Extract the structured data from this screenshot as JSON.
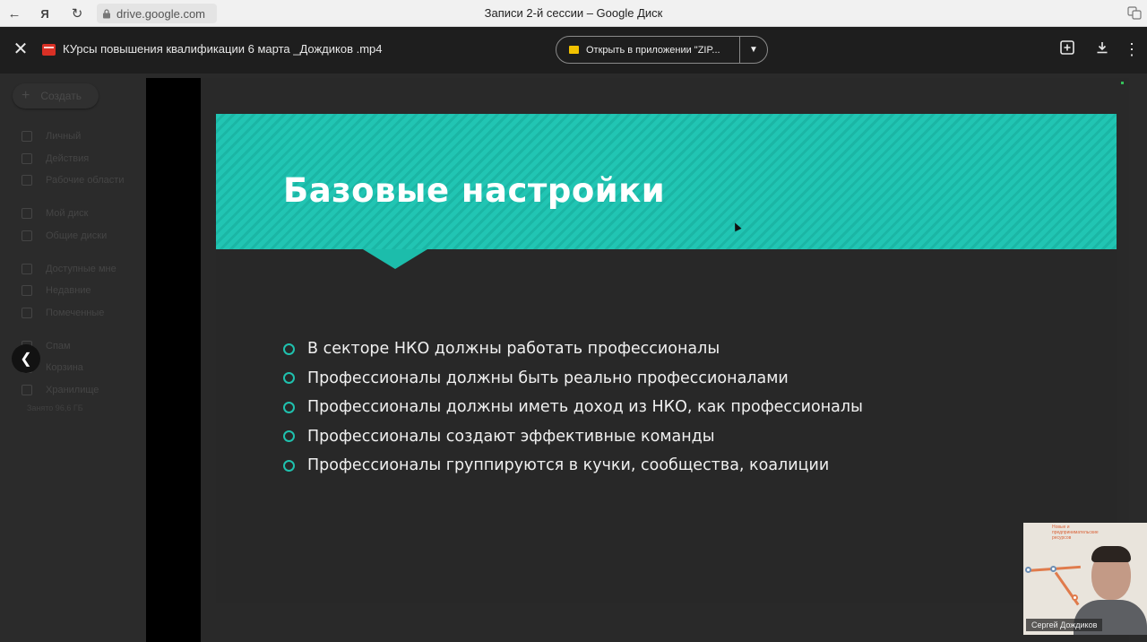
{
  "browser": {
    "url": "drive.google.com",
    "tab_title": "Записи 2-й сессии – Google Диск"
  },
  "viewer": {
    "file_name": "КУрсы повышения квалификации 6 марта _Дождиков .mp4",
    "open_with_label": "Открыть в приложении \"ZIP...",
    "icons": [
      "close-icon",
      "video-file-icon",
      "add-to-drive-icon",
      "download-icon",
      "more-vert-icon"
    ]
  },
  "sidebar": {
    "create_label": "Создать",
    "items": [
      {
        "label": "Личный"
      },
      {
        "label": "Действия"
      },
      {
        "label": "Рабочие области"
      },
      {
        "label": "Мой диск"
      },
      {
        "label": "Общие диски"
      },
      {
        "label": "Доступные мне"
      },
      {
        "label": "Недавние"
      },
      {
        "label": "Помеченные"
      },
      {
        "label": "Спам"
      },
      {
        "label": "Корзина"
      },
      {
        "label": "Хранилище"
      }
    ],
    "storage_text": "Занято 96,6 ГБ"
  },
  "slide": {
    "title": "Базовые настройки",
    "bullets": [
      "В секторе НКО должны работать профессионалы",
      "Профессионалы должны быть реально профессионалами",
      "Профессионалы должны иметь доход из НКО, как профессионалы",
      "Профессионалы создают эффективные команды",
      "Профессионалы группируются в кучки, сообщества, коалиции"
    ],
    "accent_color": "#21c5b3"
  },
  "webcam": {
    "name": "Сергей Дождиков",
    "wall_note": "Новые и предпринимательские ресурсов"
  }
}
